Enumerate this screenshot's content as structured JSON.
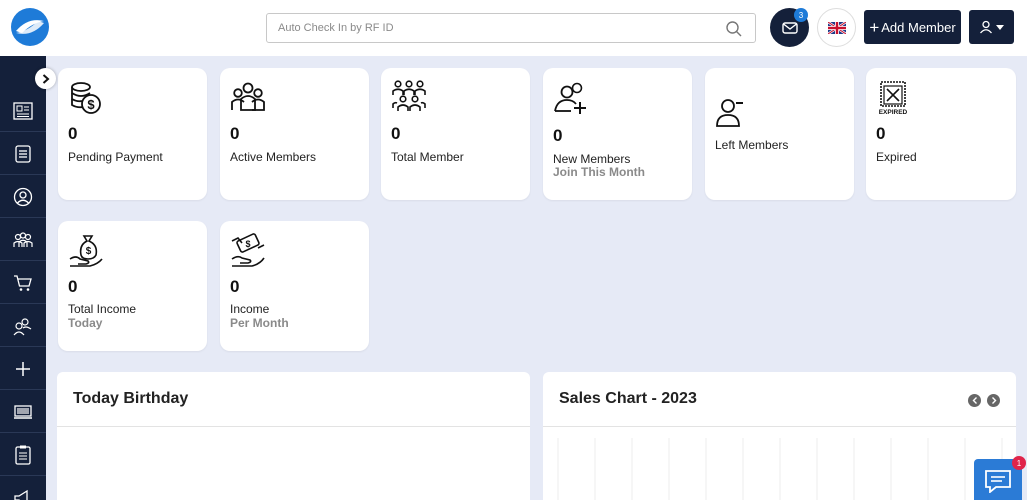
{
  "header": {
    "search_placeholder": "Auto Check In by RF ID",
    "mail_badge": "3",
    "add_member_label": "Add Member",
    "add_member_plus": "+"
  },
  "colors": {
    "navy": "#14203a",
    "background": "#e6eaf6",
    "accent_blue": "#1e7bd8",
    "chat_badge": "#e0244a"
  },
  "sidebar": {
    "items": [
      {
        "icon": "dashboard-card-icon"
      },
      {
        "icon": "list-icon"
      },
      {
        "icon": "user-circle-icon"
      },
      {
        "icon": "members-group-icon"
      },
      {
        "icon": "cart-icon"
      },
      {
        "icon": "users-icon"
      },
      {
        "icon": "plus-icon"
      },
      {
        "icon": "monitor-icon"
      },
      {
        "icon": "clipboard-icon"
      },
      {
        "icon": "megaphone-icon"
      }
    ]
  },
  "cards": [
    {
      "value": "0",
      "label": "Pending Payment",
      "icon": "coins-dollar-icon"
    },
    {
      "value": "0",
      "label": "Active Members",
      "icon": "group-icon"
    },
    {
      "value": "0",
      "label": "Total Member",
      "icon": "crowd-icon"
    },
    {
      "value": "0",
      "label": "New Members",
      "sub": "Join This Month",
      "icon": "user-add-icon"
    },
    {
      "value": "",
      "label": "Left Members",
      "icon": "user-minus-icon"
    },
    {
      "value": "0",
      "label": "Expired",
      "icon": "expired-ticket-icon",
      "icon_text": "EXPIRED"
    },
    {
      "value": "0",
      "label": "Total Income",
      "sub": "Today",
      "icon": "money-bag-hand-icon"
    },
    {
      "value": "0",
      "label": "Income",
      "sub": "Per Month",
      "icon": "money-exchange-icon"
    }
  ],
  "panels": {
    "birthday_title": "Today Birthday",
    "sales_title": "Sales Chart - 2023"
  },
  "chat": {
    "badge": "1"
  }
}
